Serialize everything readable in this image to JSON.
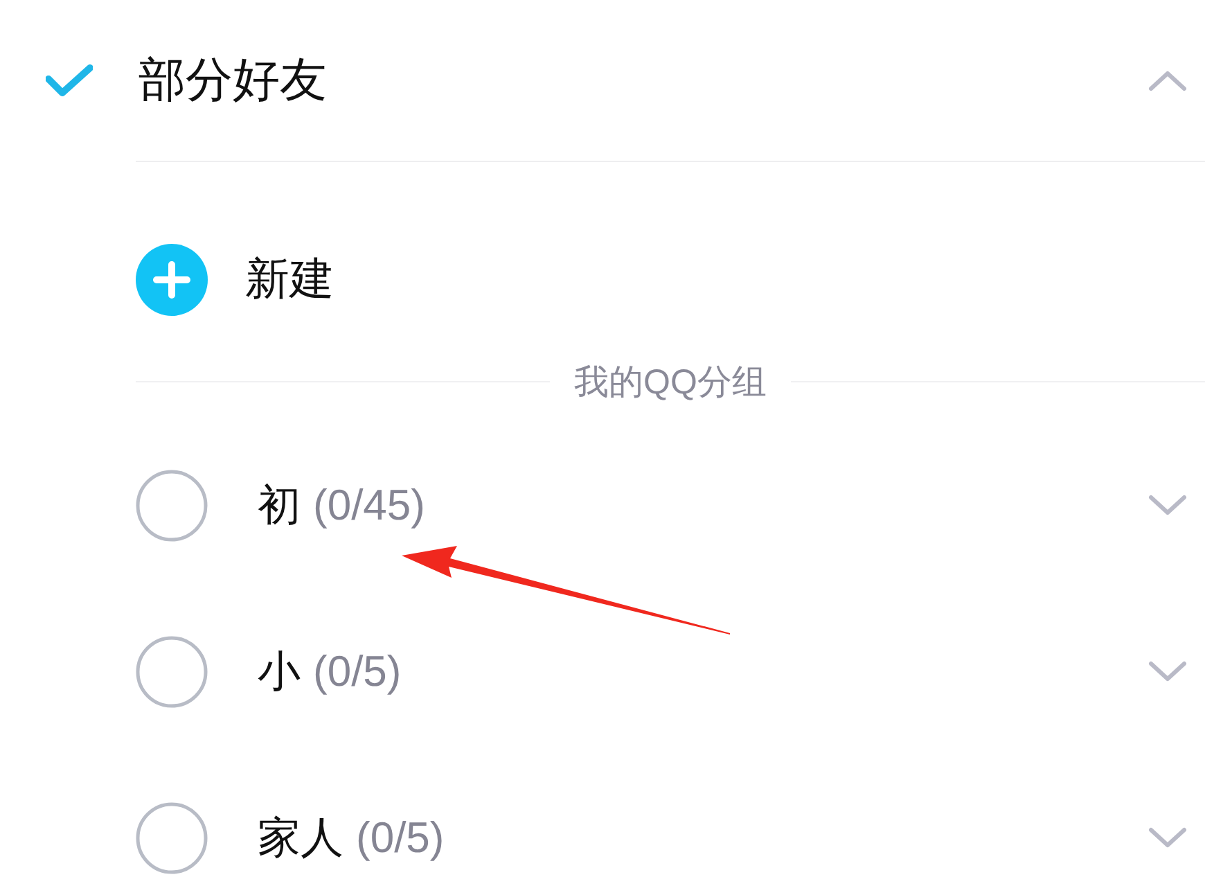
{
  "option": {
    "label": "部分好友",
    "checked": true,
    "expanded": true
  },
  "new_button": {
    "label": "新建"
  },
  "section": {
    "title": "我的QQ分组"
  },
  "groups": [
    {
      "name": "初",
      "count": "(0/45)",
      "selected": false,
      "expanded": false
    },
    {
      "name": "小",
      "count": "(0/5)",
      "selected": false,
      "expanded": false
    },
    {
      "name": "家人",
      "count": "(0/5)",
      "selected": false,
      "expanded": false
    }
  ],
  "annotations": [
    {
      "kind": "arrow"
    }
  ]
}
